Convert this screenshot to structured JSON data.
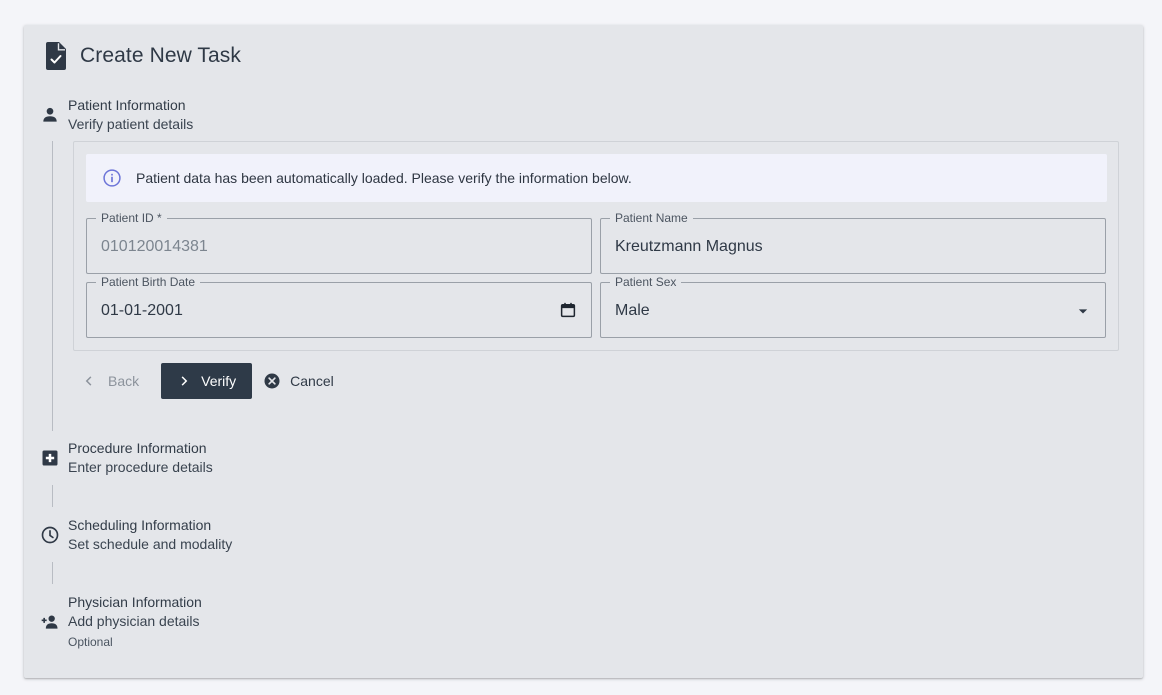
{
  "header": {
    "title": "Create New Task",
    "icon": "document-check-icon"
  },
  "colors": {
    "primary": "#2e3a48",
    "card_bg": "#e4e6ea",
    "info_bg": "#f1f2fb",
    "info_icon": "#6c74d8"
  },
  "steps": [
    {
      "title": "Patient Information",
      "subtitle": "Verify patient details",
      "icon": "person-icon",
      "active": true
    },
    {
      "title": "Procedure Information",
      "subtitle": "Enter procedure details",
      "icon": "medical-plus-icon"
    },
    {
      "title": "Scheduling Information",
      "subtitle": "Set schedule and modality",
      "icon": "clock-icon"
    },
    {
      "title": "Physician Information",
      "subtitle": "Add physician details",
      "optional": "Optional",
      "icon": "person-add-icon"
    }
  ],
  "alert": {
    "text": "Patient data has been automatically loaded. Please verify the information below.",
    "icon": "info-icon"
  },
  "form": {
    "patient_id": {
      "label": "Patient ID *",
      "value": "010120014381",
      "disabled": true
    },
    "patient_name": {
      "label": "Patient Name",
      "value": "Kreutzmann Magnus"
    },
    "birth_date": {
      "label": "Patient Birth Date",
      "value": "01-01-2001",
      "icon": "calendar-icon"
    },
    "sex": {
      "label": "Patient Sex",
      "value": "Male",
      "icon": "dropdown-caret-icon"
    }
  },
  "actions": {
    "back": "Back",
    "verify": "Verify",
    "cancel": "Cancel"
  }
}
